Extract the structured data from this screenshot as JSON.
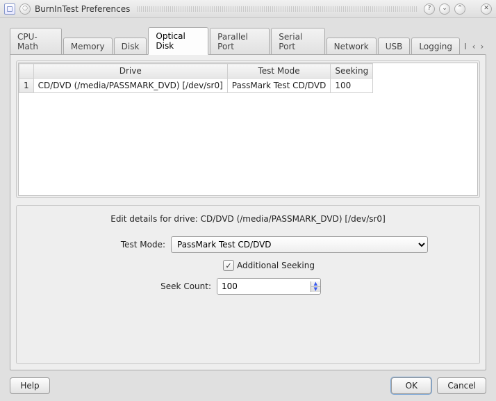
{
  "window": {
    "title": "BurnInTest Preferences"
  },
  "tabs": {
    "items": [
      "CPU-Math",
      "Memory",
      "Disk",
      "Optical Disk",
      "Parallel Port",
      "Serial Port",
      "Network",
      "USB",
      "Logging"
    ],
    "active_index": 3,
    "overflow_hint": "I"
  },
  "drive_table": {
    "headers": {
      "drive": "Drive",
      "test_mode": "Test Mode",
      "seeking": "Seeking"
    },
    "rows": [
      {
        "num": "1",
        "drive": "CD/DVD (/media/PASSMARK_DVD) [/dev/sr0]",
        "test_mode": "PassMark Test CD/DVD",
        "seeking": "100"
      }
    ]
  },
  "edit": {
    "title": "Edit details for drive: CD/DVD (/media/PASSMARK_DVD) [/dev/sr0]",
    "test_mode_label": "Test Mode:",
    "test_mode_value": "PassMark Test CD/DVD",
    "additional_seeking_label": "Additional Seeking",
    "additional_seeking_checked": true,
    "seek_count_label": "Seek Count:",
    "seek_count_value": "100"
  },
  "buttons": {
    "help": "Help",
    "ok": "OK",
    "cancel": "Cancel"
  }
}
